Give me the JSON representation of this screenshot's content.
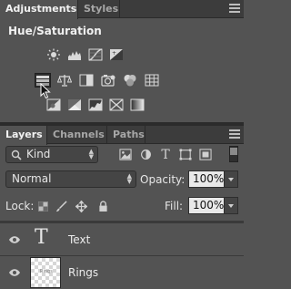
{
  "adjustments_panel": {
    "tabs": [
      "Adjustments",
      "Styles"
    ],
    "title": "Hue/Saturation",
    "icons_row1": [
      "brightness-contrast-icon",
      "levels-icon",
      "curves-icon",
      "exposure-icon"
    ],
    "icons_row2": [
      "hue-saturation-icon",
      "color-balance-icon",
      "black-white-icon",
      "photo-filter-icon",
      "channel-mixer-icon",
      "color-lookup-icon"
    ],
    "icons_row3": [
      "invert-icon",
      "posterize-icon",
      "threshold-icon",
      "selective-color-icon",
      "gradient-map-icon"
    ]
  },
  "layers_panel": {
    "tabs": [
      "Layers",
      "Channels",
      "Paths"
    ],
    "filter": {
      "value": "Kind"
    },
    "blend_mode": {
      "value": "Normal"
    },
    "opacity": {
      "label": "Opacity:",
      "value": "100%"
    },
    "lock": {
      "label": "Lock:"
    },
    "fill": {
      "label": "Fill:",
      "value": "100%"
    },
    "layers": [
      {
        "name": "Text",
        "type": "text"
      },
      {
        "name": "Rings",
        "type": "pixel",
        "thumb_caption": "Rings"
      }
    ]
  },
  "colors": {
    "panel_bg": "#535353",
    "tab_bar": "#3c3c3c",
    "field_light": "#e9e9e9"
  }
}
